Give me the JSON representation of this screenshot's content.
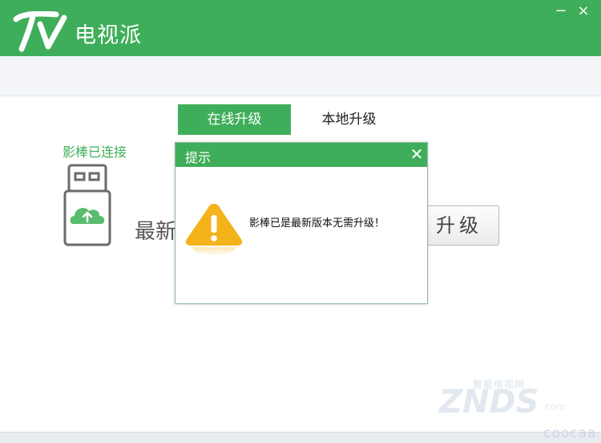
{
  "window": {
    "app_name": "电视派",
    "minimize_glyph": "−",
    "close_glyph": "×"
  },
  "tabs": {
    "online_label": "在线升级",
    "local_label": "本地升级"
  },
  "device": {
    "status": "影棒已连接",
    "icon": "usb-dongle-cloud-upload-icon"
  },
  "main": {
    "partial_text": "最新",
    "upgrade_button": "升级"
  },
  "dialog": {
    "title": "提示",
    "close_glyph": "✕",
    "message": "影棒已是最新版本无需升级！",
    "icon": "warning-icon"
  },
  "watermark": {
    "small": "智能电视网",
    "brand": "ZNDS",
    "domain": ".com",
    "corner": "coocaa"
  },
  "colors": {
    "brand_green": "#3fae5a",
    "warning_yellow": "#f4b31b"
  }
}
